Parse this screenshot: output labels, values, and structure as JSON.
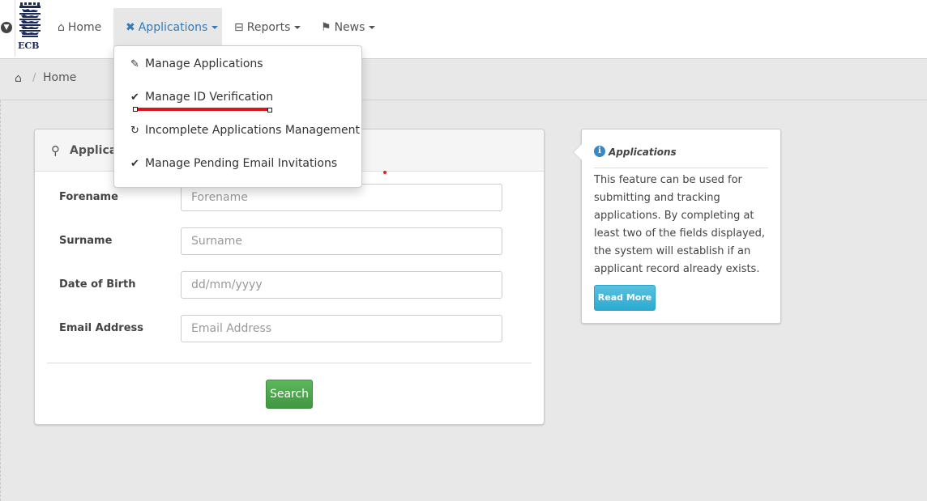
{
  "nav": {
    "logo_text": "ECB",
    "items": [
      {
        "label": "Home",
        "icon": "home-icon"
      },
      {
        "label": "Applications",
        "icon": "tools-icon",
        "active": true
      },
      {
        "label": "Reports",
        "icon": "sliders-icon"
      },
      {
        "label": "News",
        "icon": "flag-icon"
      }
    ]
  },
  "breadcrumb": {
    "label": "Home",
    "separator": "/"
  },
  "dropdown": {
    "items": [
      {
        "label": "Manage Applications",
        "icon": "edit-icon"
      },
      {
        "label": "Manage ID Verification",
        "icon": "check-circle-icon"
      },
      {
        "label": "Incomplete Applications Management",
        "icon": "spinner-icon"
      },
      {
        "label": "Manage Pending Email Invitations",
        "icon": "check-circle-icon"
      }
    ]
  },
  "search_panel": {
    "title": "Applicar",
    "fields": [
      {
        "label": "Forename",
        "placeholder": "Forename"
      },
      {
        "label": "Surname",
        "placeholder": "Surname"
      },
      {
        "label": "Date of Birth",
        "placeholder": "dd/mm/yyyy"
      },
      {
        "label": "Email Address",
        "placeholder": "Email Address"
      }
    ],
    "search_label": "Search"
  },
  "info_panel": {
    "title": "Applications",
    "body": "This feature can be used for submitting and tracking applications. By completing at least two of the fields displayed, the system will establish if an applicant record already exists.",
    "read_more_label": "Read More"
  },
  "colors": {
    "accent": "#337ab7",
    "success": "#5cb85c",
    "info": "#5bc0de",
    "highlight": "#d9151d"
  }
}
